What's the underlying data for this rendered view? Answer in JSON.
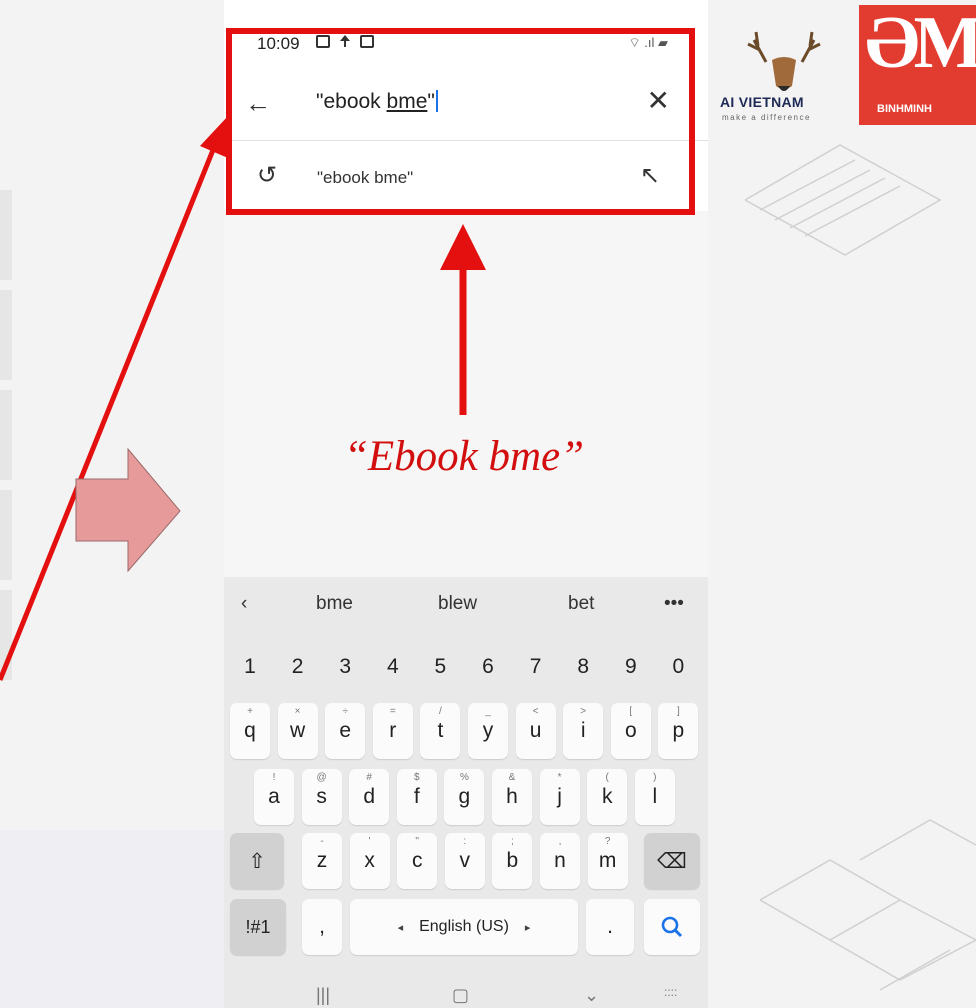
{
  "status": {
    "time": "10:09"
  },
  "search": {
    "prefix": "\"ebook ",
    "underlined": "bme",
    "suffix": "\""
  },
  "suggestion": {
    "text": "\"ebook bme\""
  },
  "callout": {
    "text": "“Ebook bme”"
  },
  "logos": {
    "ai_vietnam": "AI VIETNAM",
    "ai_tagline": "make a difference",
    "binhminh": "BINHMINH"
  },
  "keyboard": {
    "predictions": [
      "bme",
      "blew",
      "bet"
    ],
    "numbers": [
      "1",
      "2",
      "3",
      "4",
      "5",
      "6",
      "7",
      "8",
      "9",
      "0"
    ],
    "row1": [
      {
        "k": "q",
        "h": "+"
      },
      {
        "k": "w",
        "h": "×"
      },
      {
        "k": "e",
        "h": "÷"
      },
      {
        "k": "r",
        "h": "="
      },
      {
        "k": "t",
        "h": "/"
      },
      {
        "k": "y",
        "h": "_"
      },
      {
        "k": "u",
        "h": "<"
      },
      {
        "k": "i",
        "h": ">"
      },
      {
        "k": "o",
        "h": "["
      },
      {
        "k": "p",
        "h": "]"
      }
    ],
    "row2": [
      {
        "k": "a",
        "h": "!"
      },
      {
        "k": "s",
        "h": "@"
      },
      {
        "k": "d",
        "h": "#"
      },
      {
        "k": "f",
        "h": "$"
      },
      {
        "k": "g",
        "h": "%"
      },
      {
        "k": "h",
        "h": "&"
      },
      {
        "k": "j",
        "h": "*"
      },
      {
        "k": "k",
        "h": "("
      },
      {
        "k": "l",
        "h": ")"
      }
    ],
    "row3": [
      {
        "k": "z",
        "h": "-"
      },
      {
        "k": "x",
        "h": "'"
      },
      {
        "k": "c",
        "h": "\""
      },
      {
        "k": "v",
        "h": ":"
      },
      {
        "k": "b",
        "h": ";"
      },
      {
        "k": "n",
        "h": ","
      },
      {
        "k": "m",
        "h": "?"
      }
    ],
    "symbols_label": "!#1",
    "comma": ",",
    "space_label": "English (US)",
    "period": "."
  },
  "colors": {
    "highlight": "#e41010",
    "search_key": "#1a73e8"
  }
}
